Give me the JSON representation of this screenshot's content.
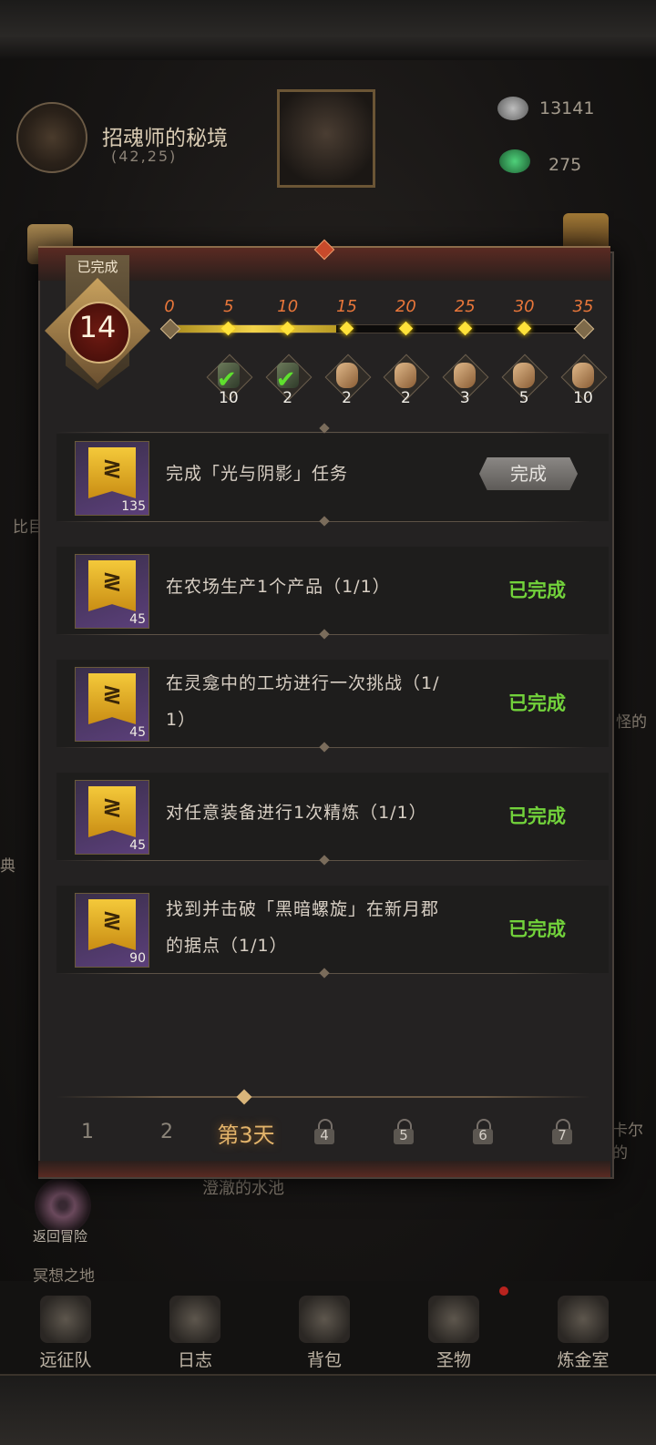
{
  "background": {
    "realm_title": "招魂师的秘境",
    "coordinates": "(42,25)",
    "resources": [
      {
        "name": "silver-coin",
        "value": "13141",
        "color": "#9a9a9a"
      },
      {
        "name": "green-gem",
        "value": "275",
        "color": "#2f8f4a"
      }
    ],
    "side_texts": [
      "比目",
      "典",
      "卡尔的",
      "怪的"
    ],
    "location_label": "澄澈的水池",
    "return_label": "返回冒险",
    "area_label": "冥想之地"
  },
  "nav": [
    {
      "label": "远征队",
      "icon": "viking-helmet-icon"
    },
    {
      "label": "日志",
      "icon": "scroll-log-icon"
    },
    {
      "label": "背包",
      "icon": "backpack-icon"
    },
    {
      "label": "圣物",
      "icon": "relic-icon"
    },
    {
      "label": "炼金室",
      "icon": "alchemy-icon"
    }
  ],
  "modal": {
    "badge_label": "已完成",
    "completed_count": "14",
    "progress": {
      "milestones": [
        "0",
        "5",
        "10",
        "15",
        "20",
        "25",
        "30",
        "35"
      ],
      "current": 14,
      "max": 35
    },
    "rewards": [
      {
        "count": "10",
        "icon": "book-icon",
        "claimed": true
      },
      {
        "count": "2",
        "icon": "book-icon",
        "claimed": true
      },
      {
        "count": "2",
        "icon": "scroll-icon",
        "claimed": false
      },
      {
        "count": "2",
        "icon": "scroll-icon",
        "claimed": false
      },
      {
        "count": "3",
        "icon": "scroll-icon",
        "claimed": false
      },
      {
        "count": "5",
        "icon": "scroll-icon",
        "claimed": false
      },
      {
        "count": "10",
        "icon": "scroll-icon",
        "claimed": false
      }
    ],
    "tasks": [
      {
        "line1": "完成「光与阴影」任务",
        "line2": "",
        "points": "135",
        "status": "完成",
        "status_type": "button"
      },
      {
        "line1": "在农场生产1个产品（1/1）",
        "line2": "",
        "points": "45",
        "status": "已完成",
        "status_type": "done"
      },
      {
        "line1": "在灵龛中的工坊进行一次挑战（1/",
        "line2": "1）",
        "points": "45",
        "status": "已完成",
        "status_type": "done"
      },
      {
        "line1": "对任意装备进行1次精炼（1/1）",
        "line2": "",
        "points": "45",
        "status": "已完成",
        "status_type": "done"
      },
      {
        "line1": "找到并击破「黑暗螺旋」在新月郡",
        "line2": "的据点（1/1）",
        "points": "90",
        "status": "已完成",
        "status_type": "done"
      }
    ],
    "days": [
      "1",
      "2",
      "第3天",
      "4",
      "5",
      "6",
      "7"
    ],
    "active_day": 2
  },
  "colors": {
    "done_green": "#72d23b",
    "milestone_orange": "#e8763a",
    "progress_gold": "#f2d34a"
  }
}
